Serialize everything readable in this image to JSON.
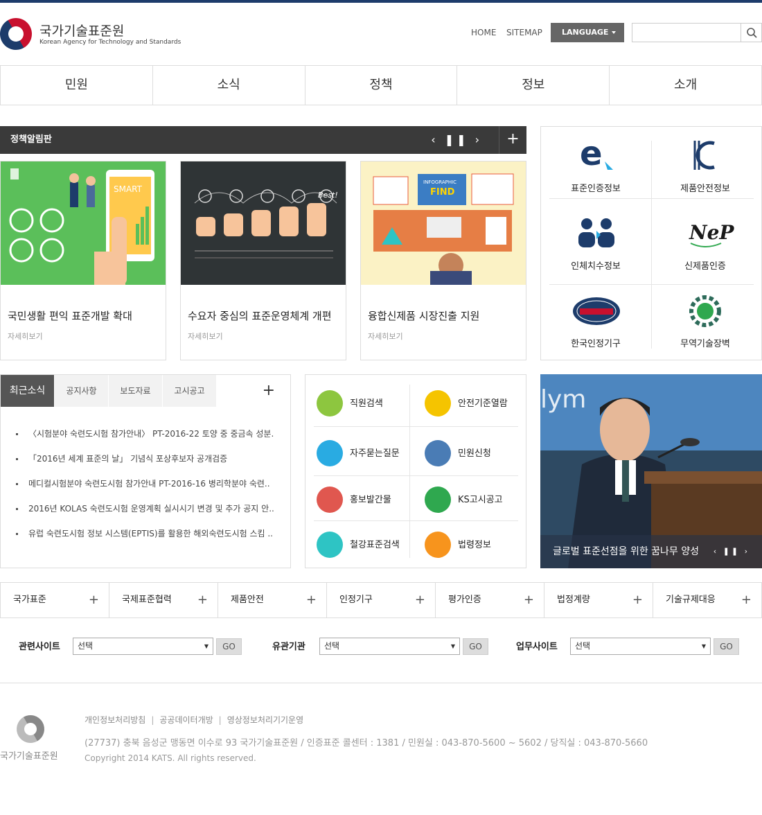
{
  "header": {
    "org_name": "국가기술표준원",
    "org_sub": "Korean Agency for Technology and Standards",
    "home": "HOME",
    "sitemap": "SITEMAP",
    "language": "LANGUAGE"
  },
  "gnb": [
    "민원",
    "소식",
    "정책",
    "정보",
    "소개"
  ],
  "notice": {
    "title": "정책알림판",
    "cards": [
      {
        "title": "국민생활 편익 표준개발 확대",
        "more": "자세히보기"
      },
      {
        "title": "수요자 중심의 표준운영체계 개편",
        "more": "자세히보기"
      },
      {
        "title": "융합신제품 시장진출 지원",
        "more": "자세히보기"
      }
    ],
    "card2_img": {
      "find": "FIND",
      "infographic": "INFOGRAPHIC",
      "smart": "SMART",
      "best": "Best!"
    }
  },
  "quick": [
    {
      "label": "표준인증정보",
      "icon": "e-certification-icon"
    },
    {
      "label": "제품안전정보",
      "icon": "kc-mark-icon"
    },
    {
      "label": "인체치수정보",
      "icon": "people-icon"
    },
    {
      "label": "신제품인증",
      "icon": "nep-icon"
    },
    {
      "label": "한국인정기구",
      "icon": "kolas-icon"
    },
    {
      "label": "무역기술장벽",
      "icon": "globe-gear-icon"
    }
  ],
  "news": {
    "tabs": [
      "최근소식",
      "공지사항",
      "보도자료",
      "고시공고"
    ],
    "items": [
      "〈시험분야 숙련도시험 참가안내〉 PT-2016-22 토양 중 중금속 성분..",
      "「2016년 세계 표준의 날」 기념식 포상후보자 공개검증",
      "메디컬시험분야 숙련도시험 참가안내 PT-2016-16 병리학분야 숙련..",
      "2016년 KOLAS 숙련도시험 운영계획 실시시기 변경 및 추가 공지 안..",
      "유럽 숙련도시험 정보 시스템(EPTIS)를 활용한 해외숙련도시험 스킴 .."
    ]
  },
  "services": [
    {
      "label": "직원검색",
      "color": "#8dc63f"
    },
    {
      "label": "안전기준열람",
      "color": "#f5c400"
    },
    {
      "label": "자주묻는질문",
      "color": "#29abe2"
    },
    {
      "label": "민원신청",
      "color": "#4a7cb5"
    },
    {
      "label": "홍보발간물",
      "color": "#e0574f"
    },
    {
      "label": "KS고시공고",
      "color": "#2fa84f"
    },
    {
      "label": "철강표준검색",
      "color": "#2ec4c4"
    },
    {
      "label": "법령정보",
      "color": "#f7941d"
    }
  ],
  "photo": {
    "caption": "글로벌 표준선점을 위한 꿈나무 양성",
    "bg_text": "lym"
  },
  "categories": [
    "국가표준",
    "국제표준협력",
    "제품안전",
    "인정기구",
    "평가인증",
    "법정계량",
    "기술규제대응"
  ],
  "selects": [
    {
      "label": "관련사이트",
      "value": "선택",
      "go": "GO"
    },
    {
      "label": "유관기관",
      "value": "선택",
      "go": "GO"
    },
    {
      "label": "업무사이트",
      "value": "선택",
      "go": "GO"
    }
  ],
  "footer": {
    "org": "국가기술표준원",
    "links": [
      "개인정보처리방침",
      "공공데이터개방",
      "영상정보처리기기운영"
    ],
    "address": "(27737) 충북 음성군 맹동면 이수로 93 국가기술표준원 / 인증표준 콜센터 : 1381 / 민원실 : 043-870-5600 ~ 5602 / 당직실 : 043-870-5660",
    "copyright": "Copyright 2014 KATS. All rights reserved."
  }
}
